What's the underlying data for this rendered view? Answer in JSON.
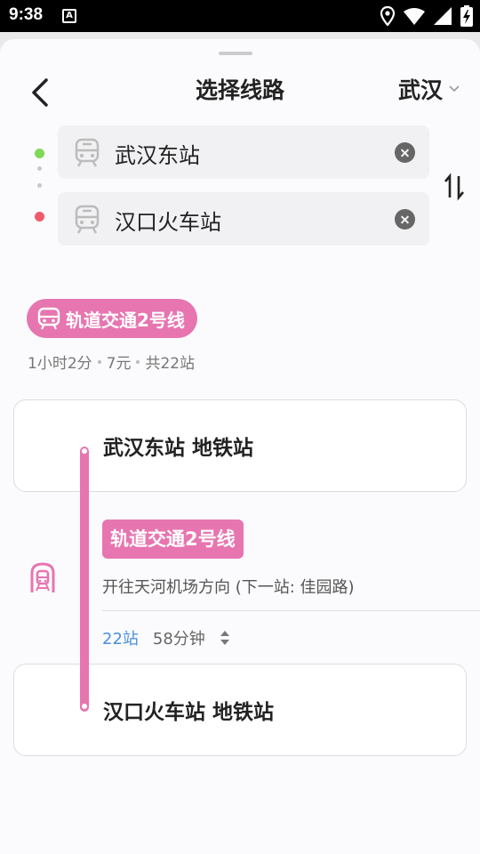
{
  "status_bar": {
    "time": "9:38",
    "notification_letter": "A",
    "icons": [
      "location-icon",
      "wifi-icon",
      "signal-icon",
      "battery-charging-icon"
    ]
  },
  "header": {
    "title": "选择线路",
    "city": "武汉",
    "back_icon": "chevron-left-icon",
    "city_dropdown_icon": "chevron-down-icon"
  },
  "origin": {
    "value": "武汉东站",
    "icon": "train-icon",
    "dot_color": "#7ed957"
  },
  "destination": {
    "value": "汉口火车站",
    "icon": "train-icon",
    "dot_color": "#f05b6b"
  },
  "swap_icon": "swap-vertical-icon",
  "route": {
    "badge_label": "轨道交通2号线",
    "badge_color": "#e775b0",
    "duration": "1小时2分",
    "price": "7元",
    "stops_total": "共22站"
  },
  "segment": {
    "start_station": "武汉东站 地铁站",
    "line_tag": "轨道交通2号线",
    "direction": "开往天河机场方向 (下一站: 佳园路)",
    "stops": "22站",
    "duration": "58分钟",
    "end_station": "汉口火车站 地铁站",
    "metro_icon": "metro-icon",
    "expand_icon": "expand-updown-icon"
  }
}
